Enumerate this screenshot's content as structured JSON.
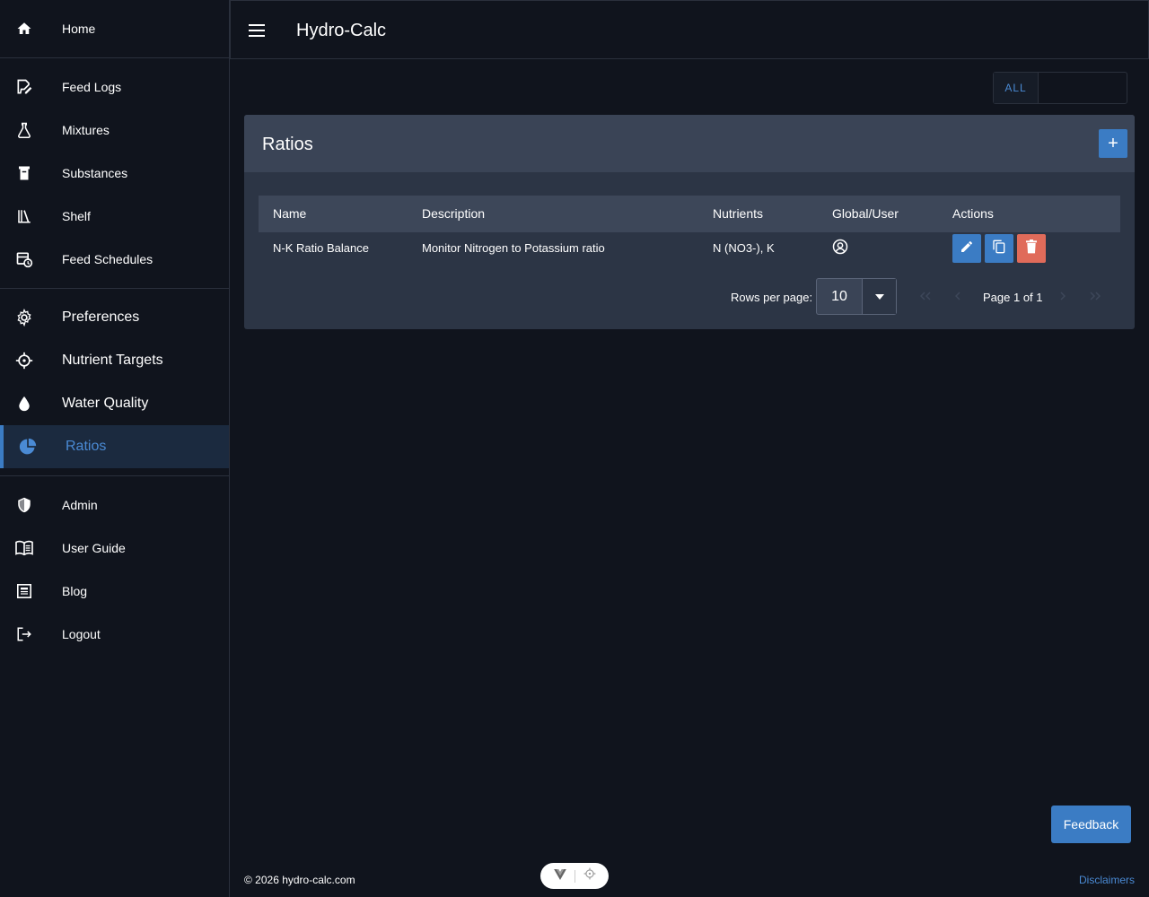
{
  "app": {
    "title": "Hydro-Calc"
  },
  "nav": {
    "group1": [
      {
        "label": "Home",
        "icon": "home-icon"
      }
    ],
    "group2": [
      {
        "label": "Feed Logs",
        "icon": "feed-logs-icon"
      },
      {
        "label": "Mixtures",
        "icon": "flask-icon"
      },
      {
        "label": "Substances",
        "icon": "container-icon"
      },
      {
        "label": "Shelf",
        "icon": "shelf-icon"
      },
      {
        "label": "Feed Schedules",
        "icon": "calendar-clock-icon"
      }
    ],
    "group3": [
      {
        "label": "Preferences",
        "icon": "gear-icon"
      },
      {
        "label": "Nutrient Targets",
        "icon": "crosshair-icon"
      },
      {
        "label": "Water Quality",
        "icon": "water-drop-icon"
      },
      {
        "label": "Ratios",
        "icon": "pie-chart-icon"
      }
    ],
    "group4": [
      {
        "label": "Admin",
        "icon": "shield-icon"
      },
      {
        "label": "User Guide",
        "icon": "book-icon"
      },
      {
        "label": "Blog",
        "icon": "news-icon"
      },
      {
        "label": "Logout",
        "icon": "logout-icon"
      }
    ]
  },
  "toggle": {
    "all_label": "ALL"
  },
  "card": {
    "title": "Ratios",
    "add_label": "+",
    "columns": [
      "Name",
      "Description",
      "Nutrients",
      "Global/User",
      "Actions"
    ],
    "rows": [
      {
        "name": "N-K Ratio Balance",
        "description": "Monitor Nitrogen to Potassium ratio",
        "nutrients": "N (NO3-), K",
        "scope_icon": "user-circle-icon"
      }
    ]
  },
  "pagination": {
    "rows_per_page_label": "Rows per page:",
    "rows_per_page_value": "10",
    "page_info": "Page 1 of 1"
  },
  "footer": {
    "copyright": "© 2026 hydro-calc.com",
    "disclaimers": "Disclaimers",
    "feedback": "Feedback"
  },
  "colors": {
    "background": "#10141d",
    "accent": "#3b7cc4",
    "danger": "#e06b5a",
    "card": "#2c3545"
  }
}
